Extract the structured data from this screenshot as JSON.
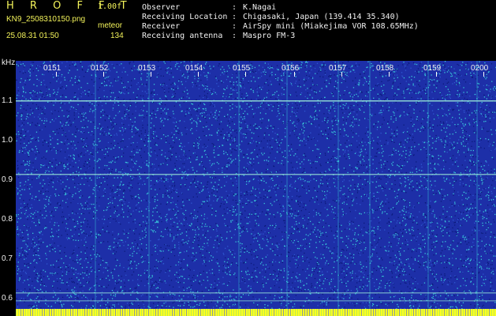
{
  "header": {
    "brand": "H R O F F T",
    "version": "1.00f",
    "filename": "KN9_2508310150.png",
    "meteor_label": "meteor",
    "datetime": "25.08.31 01:50",
    "count": "134"
  },
  "info": [
    {
      "key": "Observer",
      "value": "K.Nagai"
    },
    {
      "key": "Receiving Location",
      "value": "Chigasaki, Japan (139.414 35.340)"
    },
    {
      "key": "Receiver",
      "value": "AirSpy mini (Miakejima VOR 108.65MHz)"
    },
    {
      "key": "Receiving antenna",
      "value": "Maspro FM-3"
    }
  ],
  "axis": {
    "unit": "kHz",
    "y_ticks": [
      "1.1",
      "1.0",
      "0.9",
      "0.8",
      "0.7",
      "0.6"
    ],
    "x_ticks": [
      "0151",
      "0152",
      "0153",
      "0154",
      "0155",
      "0156",
      "0157",
      "0158",
      "0159",
      "0200"
    ]
  },
  "colors": {
    "background": "#000000",
    "spectrogram_base": "#1d2fa8",
    "noise_light": "#39c7d9",
    "noise_dark": "#0b1a7a",
    "carrier_line": "#9ff0d9",
    "bottom_band": "#ffff20",
    "label": "#f3f35a"
  }
}
